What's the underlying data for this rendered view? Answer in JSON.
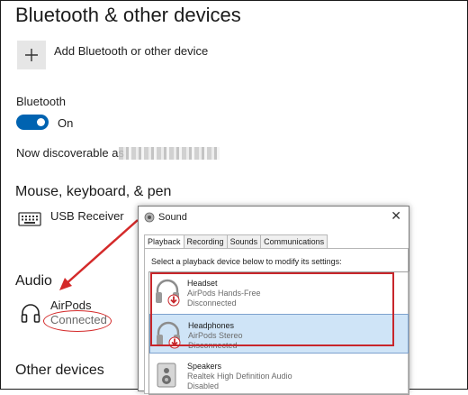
{
  "page": {
    "title": "Bluetooth & other devices",
    "add_device_label": "Add Bluetooth or other device",
    "bluetooth_label": "Bluetooth",
    "toggle_state": "On",
    "discoverable_text": "Now discoverable as"
  },
  "sections": {
    "mouse": "Mouse, keyboard, & pen",
    "audio": "Audio",
    "other": "Other devices"
  },
  "devices": {
    "usb_receiver": "USB Receiver",
    "airpods_name": "AirPods",
    "airpods_status": "Connected"
  },
  "dialog": {
    "title": "Sound",
    "close": "✕",
    "tabs": [
      "Playback",
      "Recording",
      "Sounds",
      "Communications"
    ],
    "active_tab": "Playback",
    "instruction": "Select a playback device below to modify its settings:",
    "rows": [
      {
        "name": "Headset",
        "desc": "AirPods Hands-Free",
        "status": "Disconnected"
      },
      {
        "name": "Headphones",
        "desc": "AirPods Stereo",
        "status": "Disconnected"
      },
      {
        "name": "Speakers",
        "desc": "Realtek High Definition Audio",
        "status": "Disabled"
      }
    ]
  },
  "colors": {
    "accent": "#0063b1",
    "annotation_red": "#d42a2a",
    "selected_row": "#cfe4f7"
  },
  "icons": {
    "add": "plus-icon",
    "keyboard": "keyboard-icon",
    "audio": "headphones-icon",
    "dialog": "speaker-icon",
    "device_row": "headphones-device-icon",
    "status_badge": "disconnected-down-arrow-icon",
    "speakers_row": "speakers-device-icon"
  }
}
